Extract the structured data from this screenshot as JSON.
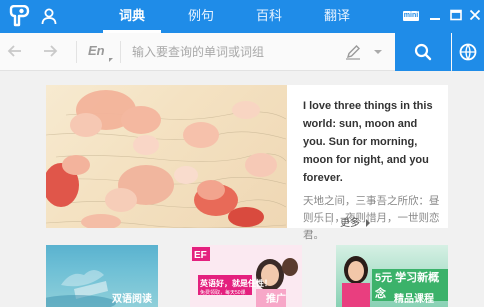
{
  "tabs": [
    {
      "label": "词典",
      "active": true
    },
    {
      "label": "例句",
      "active": false
    },
    {
      "label": "百科",
      "active": false
    },
    {
      "label": "翻译",
      "active": false
    }
  ],
  "window": {
    "mini_label": "mini"
  },
  "search": {
    "lang_label": "En",
    "placeholder": "输入要查询的单词或词组",
    "value": ""
  },
  "feature": {
    "english": "I love three things in this world: sun, moon and you. Sun for morning, moon for night, and you forever.",
    "chinese": "天地之间，三事吾之所欣：昼则乐日，夜则惜月，一世则恋君。",
    "more_label": "更多"
  },
  "cards": [
    {
      "label": "双语阅读"
    },
    {
      "label": "推广",
      "banner_text": "英语好，就是任性！",
      "banner_sub": "免费领取，每天50课"
    },
    {
      "label": "精品课程",
      "promo": "5元 学习新概念"
    }
  ],
  "colors": {
    "accent": "#1f8ce8",
    "background": "#f1f1f1"
  }
}
